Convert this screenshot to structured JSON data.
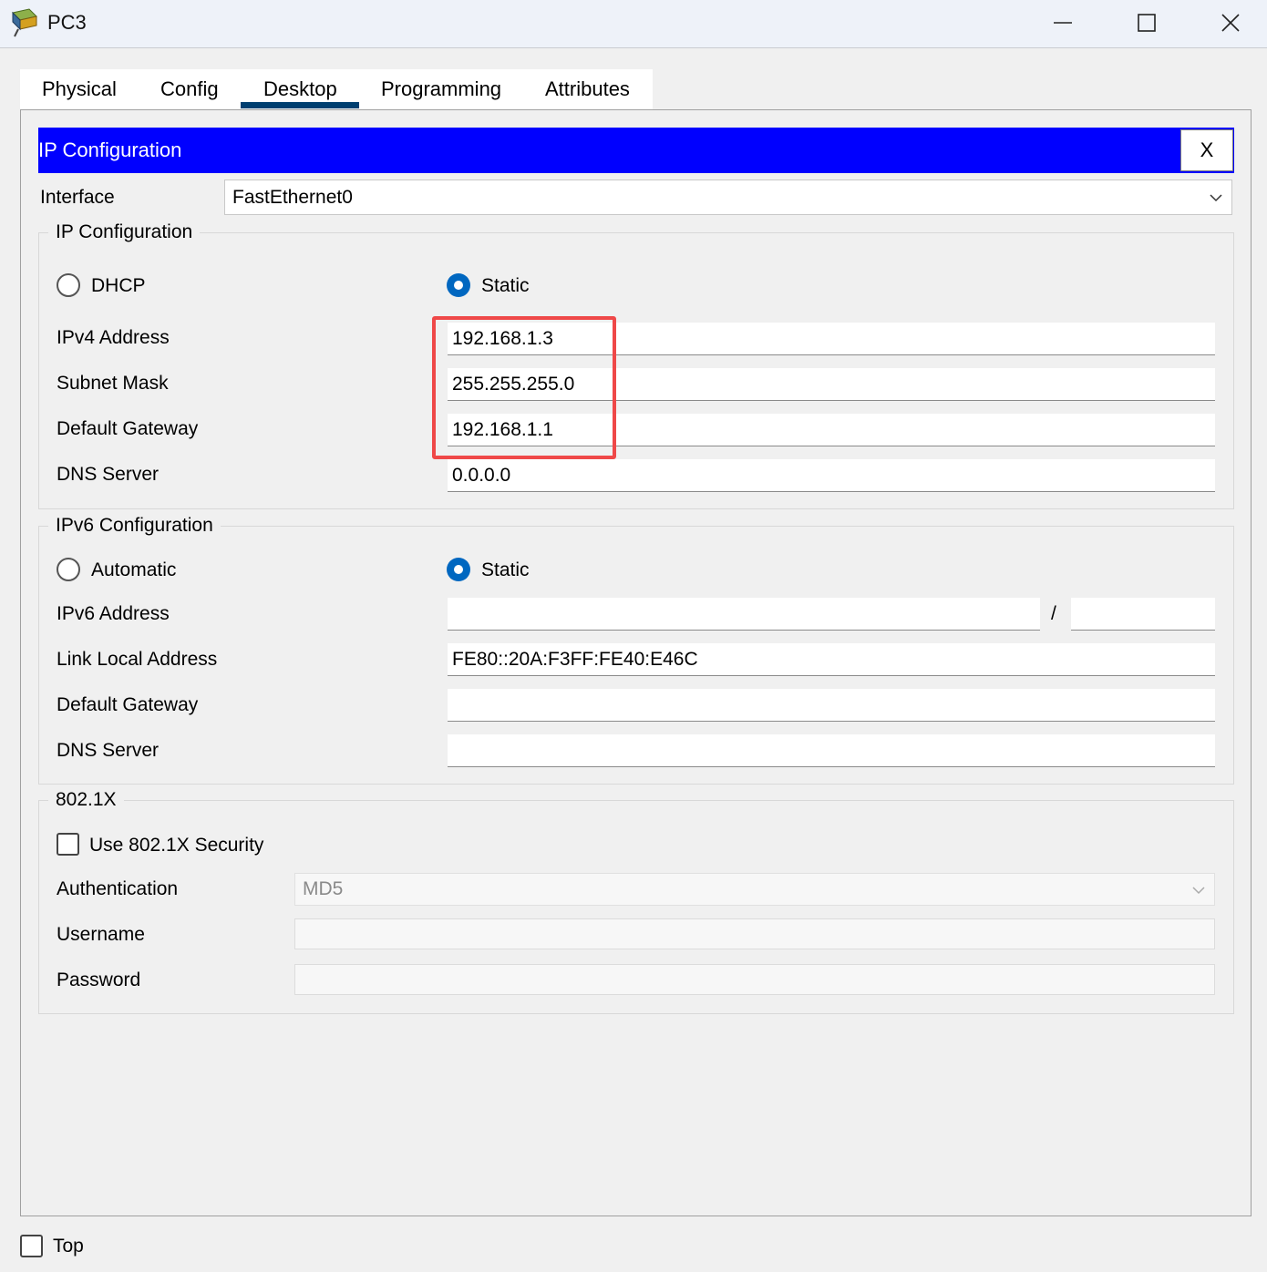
{
  "window": {
    "title": "PC3"
  },
  "tabs": [
    {
      "label": "Physical",
      "active": false
    },
    {
      "label": "Config",
      "active": false
    },
    {
      "label": "Desktop",
      "active": true
    },
    {
      "label": "Programming",
      "active": false
    },
    {
      "label": "Attributes",
      "active": false
    }
  ],
  "panel": {
    "title": "IP Configuration",
    "close_label": "X",
    "interface_label": "Interface",
    "interface_value": "FastEthernet0"
  },
  "ipv4": {
    "group_title": "IP Configuration",
    "dhcp_label": "DHCP",
    "static_label": "Static",
    "mode": "Static",
    "address_label": "IPv4 Address",
    "address": "192.168.1.3",
    "subnet_label": "Subnet Mask",
    "subnet": "255.255.255.0",
    "gateway_label": "Default Gateway",
    "gateway": "192.168.1.1",
    "dns_label": "DNS Server",
    "dns": "0.0.0.0"
  },
  "ipv6": {
    "group_title": "IPv6 Configuration",
    "automatic_label": "Automatic",
    "static_label": "Static",
    "mode": "Static",
    "address_label": "IPv6 Address",
    "address": "",
    "prefix_separator": "/",
    "prefix": "",
    "link_local_label": "Link Local Address",
    "link_local": "FE80::20A:F3FF:FE40:E46C",
    "gateway_label": "Default Gateway",
    "gateway": "",
    "dns_label": "DNS Server",
    "dns": ""
  },
  "dot1x": {
    "group_title": "802.1X",
    "use_security_label": "Use 802.1X Security",
    "use_security": false,
    "auth_label": "Authentication",
    "auth_value": "MD5",
    "username_label": "Username",
    "username": "",
    "password_label": "Password",
    "password": ""
  },
  "footer": {
    "top_label": "Top",
    "top_checked": false
  },
  "colors": {
    "panel_header": "#0000ff",
    "active_tab_underline": "#003f70",
    "radio_selected": "#0067c0",
    "highlight": "#ef4848"
  }
}
